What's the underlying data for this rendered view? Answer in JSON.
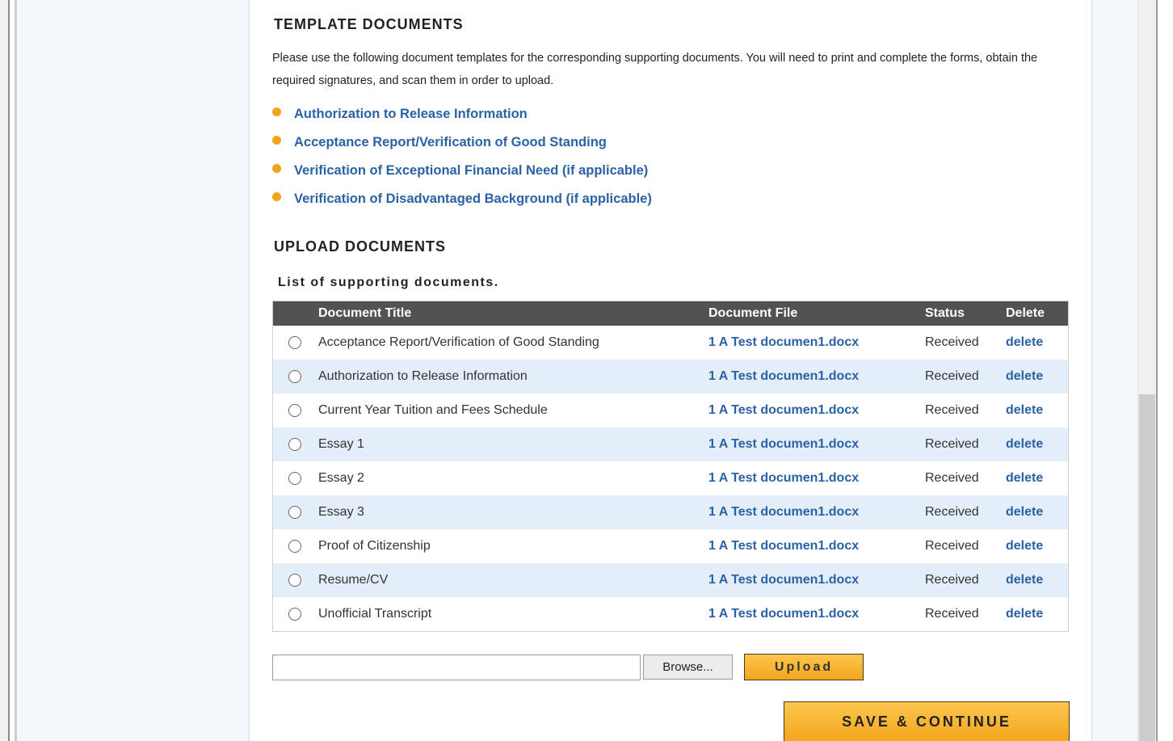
{
  "template_section": {
    "title": "TEMPLATE DOCUMENTS",
    "intro": "Please use the following document templates for the corresponding supporting documents. You will need to print and complete the forms, obtain the required signatures, and scan them in order to upload.",
    "links": [
      "Authorization to Release Information",
      "Acceptance Report/Verification of Good Standing",
      "Verification of Exceptional Financial Need (if applicable)",
      "Verification of Disadvantaged Background (if applicable)"
    ]
  },
  "upload_section": {
    "title": "UPLOAD DOCUMENTS",
    "list_caption": "List of supporting documents.",
    "columns": [
      "Document Title",
      "Document File",
      "Status",
      "Delete"
    ],
    "rows": [
      {
        "title": "Acceptance Report/Verification of Good Standing",
        "file": "1 A Test documen1.docx",
        "status": "Received",
        "action": "delete"
      },
      {
        "title": "Authorization to Release Information",
        "file": "1 A Test documen1.docx",
        "status": "Received",
        "action": "delete"
      },
      {
        "title": "Current Year Tuition and Fees Schedule",
        "file": "1 A Test documen1.docx",
        "status": "Received",
        "action": "delete"
      },
      {
        "title": "Essay 1",
        "file": "1 A Test documen1.docx",
        "status": "Received",
        "action": "delete"
      },
      {
        "title": "Essay 2",
        "file": "1 A Test documen1.docx",
        "status": "Received",
        "action": "delete"
      },
      {
        "title": "Essay 3",
        "file": "1 A Test documen1.docx",
        "status": "Received",
        "action": "delete"
      },
      {
        "title": "Proof of Citizenship",
        "file": "1 A Test documen1.docx",
        "status": "Received",
        "action": "delete"
      },
      {
        "title": "Resume/CV",
        "file": "1 A Test documen1.docx",
        "status": "Received",
        "action": "delete"
      },
      {
        "title": "Unofficial Transcript",
        "file": "1 A Test documen1.docx",
        "status": "Received",
        "action": "delete"
      }
    ],
    "file_input_value": "",
    "browse_label": "Browse...",
    "upload_label": "Upload"
  },
  "footer": {
    "save_label": "SAVE & CONTINUE"
  },
  "colors": {
    "link": "#2a62a5",
    "bullet": "#f2a51c",
    "table_header": "#525252",
    "row_alt": "#e3eef9",
    "button_top": "#fcc74d",
    "button_bottom": "#f3a51f"
  }
}
